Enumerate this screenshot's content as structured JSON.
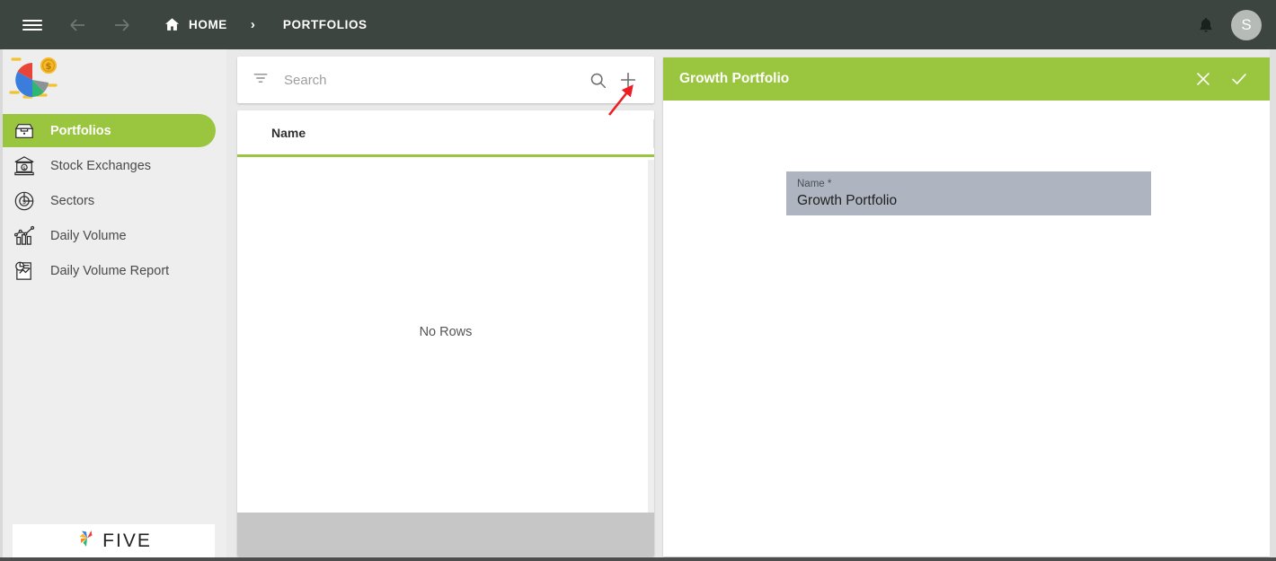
{
  "topbar": {
    "menu_icon": "hamburger-icon",
    "back_icon": "arrow-left-icon",
    "forward_icon": "arrow-right-icon",
    "home_icon": "home-icon",
    "home_label": "HOME",
    "separator": "›",
    "current_crumb": "PORTFOLIOS",
    "bell_icon": "bell-icon",
    "avatar_initial": "S"
  },
  "sidebar": {
    "logo_icon": "pie-chart-coin-logo",
    "items": [
      {
        "label": "Portfolios",
        "icon": "file-box-icon",
        "active": true
      },
      {
        "label": "Stock Exchanges",
        "icon": "bank-icon",
        "active": false
      },
      {
        "label": "Sectors",
        "icon": "pie-chart-dollar-icon",
        "active": false
      },
      {
        "label": "Daily Volume",
        "icon": "bar-chart-line-icon",
        "active": false
      },
      {
        "label": "Daily Volume Report",
        "icon": "report-chart-icon",
        "active": false
      }
    ],
    "brand": {
      "name": "FIVE",
      "icon": "five-pinwheel-logo"
    }
  },
  "list_panel": {
    "search": {
      "filter_icon": "filter-icon",
      "placeholder": "Search",
      "value": "",
      "search_icon": "search-icon",
      "add_icon": "plus-icon"
    },
    "grid": {
      "columns": [
        "Name"
      ],
      "rows": [],
      "empty_text": "No Rows"
    }
  },
  "detail_panel": {
    "title": "Growth Portfolio",
    "close_icon": "close-icon",
    "confirm_icon": "check-icon",
    "fields": [
      {
        "label": "Name *",
        "value": "Growth Portfolio"
      }
    ]
  },
  "annotation": {
    "type": "red-arrow",
    "points_to": "plus-icon",
    "color": "#ee1c25"
  },
  "colors": {
    "accent_green": "#9ac63f",
    "topbar": "#3c4540",
    "sidebar": "#eeeeee",
    "field_fill": "#aeb4c0",
    "annotation_red": "#ee1c25"
  }
}
